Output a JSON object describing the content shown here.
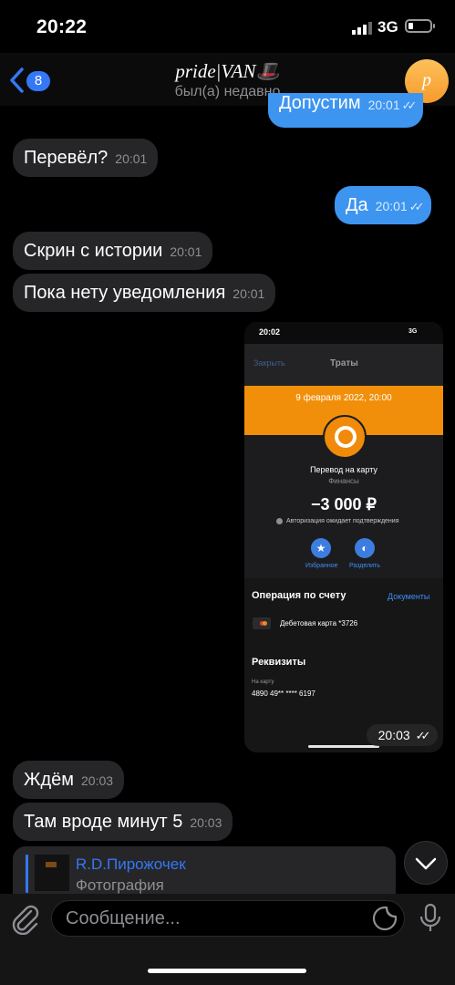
{
  "status_bar": {
    "time": "20:22",
    "network": "3G"
  },
  "header": {
    "unread_count": "8",
    "title": "pride|VAN🎩",
    "subtitle": "был(а) недавно",
    "avatar_letter": "p"
  },
  "messages": [
    {
      "direction": "out",
      "text": "Допустим",
      "time": "20:01"
    },
    {
      "direction": "in",
      "text": "Перевёл?",
      "time": "20:01"
    },
    {
      "direction": "out",
      "text": "Да",
      "time": "20:01"
    },
    {
      "direction": "in",
      "text": "Скрин с истории",
      "time": "20:01"
    },
    {
      "direction": "in",
      "text": "Пока нету уведомления",
      "time": "20:01"
    },
    {
      "direction": "in",
      "text": "Ждём",
      "time": "20:03"
    },
    {
      "direction": "in",
      "text": "Там вроде минут 5",
      "time": "20:03"
    }
  ],
  "photo_message": {
    "time": "20:03",
    "screenshot": {
      "status_time": "20:02",
      "status_network": "3G",
      "close_label": "Закрыть",
      "screen_title": "Траты",
      "date": "9 февраля 2022, 20:00",
      "transfer_label": "Перевод на карту",
      "category": "Финансы",
      "amount": "−3 000 ₽",
      "status_note": "Авторизация ожидает подтверждения",
      "favorite_label": "Избранное",
      "split_label": "Разделить",
      "operation_title": "Операция по счету",
      "documents_label": "Документы",
      "card_label": "Дебетовая карта *3726",
      "requisites_title": "Реквизиты",
      "to_card_label": "На карту",
      "card_number": "4890 49** **** 6197"
    }
  },
  "reply_preview": {
    "name": "R.D.Пирожочек",
    "kind": "Фотография"
  },
  "input": {
    "placeholder": "Сообщение..."
  },
  "colors": {
    "accent": "#3478f6",
    "outgoing_bubble": "#3d95f0",
    "incoming_bubble": "#262628",
    "qiwi_orange": "#f18f0a"
  }
}
